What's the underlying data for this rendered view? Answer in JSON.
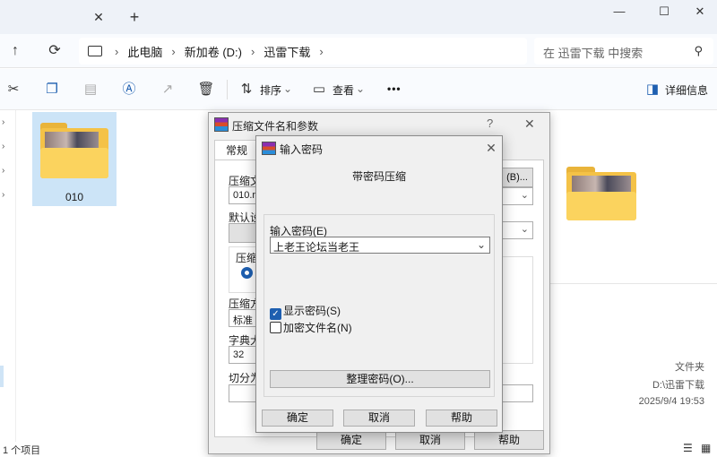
{
  "explorer": {
    "new_tab": "+",
    "tab_close": "✕",
    "window_controls": {
      "minimize": "—",
      "maximize": "☐",
      "close": "✕"
    },
    "breadcrumb": [
      "此电脑",
      "新加卷 (D:)",
      "迅雷下载"
    ],
    "search_placeholder": "在 迅雷下载 中搜索",
    "toolbar": {
      "sort": "排序",
      "view": "查看",
      "more": "•••",
      "details": "详细信息"
    },
    "folder": {
      "name": "010"
    },
    "details": {
      "type": "文件夹",
      "path": "D:\\迅雷下载",
      "date": "2025/9/4 19:53"
    },
    "status": {
      "count": "1 个项目"
    }
  },
  "rar_dialog": {
    "title": "压缩文件名和参数",
    "help": "?",
    "close": "✕",
    "tab_general": "常规",
    "archive_label": "压缩文",
    "archive_name": "010.ra",
    "browse": "(B)...",
    "default_label": "默认设",
    "format_label": "压缩",
    "method_label": "压缩方",
    "method_value": "标准",
    "dict_label": "字典大",
    "dict_value": "32",
    "split_label": "切分为",
    "ok": "确定",
    "cancel": "取消",
    "help_btn": "帮助"
  },
  "password_dialog": {
    "title": "输入密码",
    "close": "✕",
    "heading": "带密码压缩",
    "enter_label": "输入密码(E)",
    "password_value": "上老王论坛当老王",
    "show_password": "显示密码(S)",
    "show_password_checked": true,
    "encrypt_names": "加密文件名(N)",
    "encrypt_names_checked": false,
    "organize": "整理密码(O)...",
    "ok": "确定",
    "cancel": "取消",
    "help": "帮助"
  }
}
